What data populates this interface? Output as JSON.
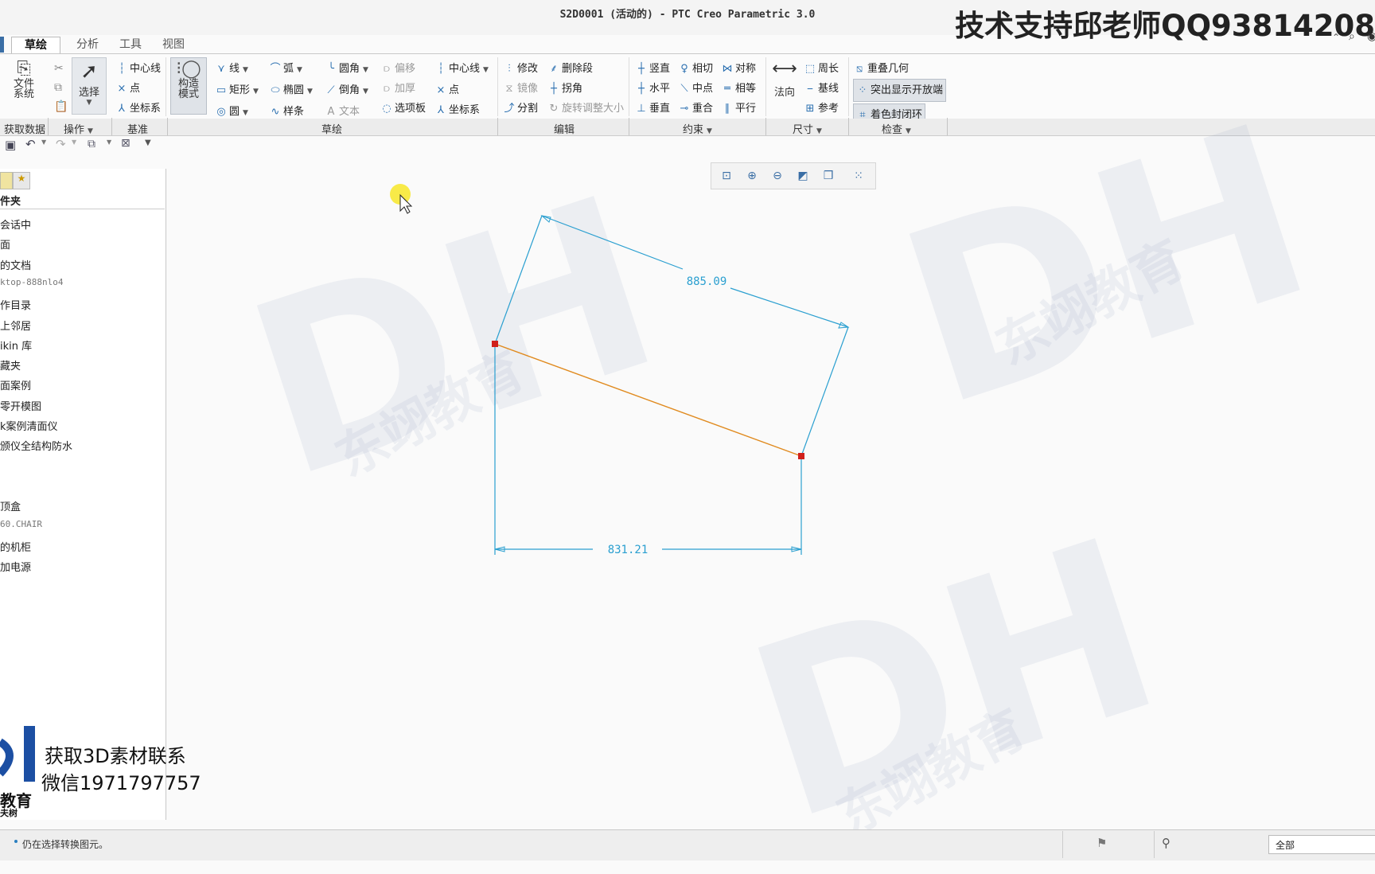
{
  "window": {
    "title": "S2D0001 (活动的) - PTC Creo Parametric 3.0",
    "overlay_contact": "技术支持邱老师QQ93814208"
  },
  "tabs": [
    {
      "label": "草绘",
      "active": true
    },
    {
      "label": "分析",
      "active": false
    },
    {
      "label": "工具",
      "active": false
    },
    {
      "label": "视图",
      "active": false
    }
  ],
  "ribbon": {
    "file_system": "文件\n系统",
    "select": "选择",
    "construct_mode": "构造\n模式",
    "datum": {
      "centerline": "中心线",
      "point": "点",
      "coord": "坐标系"
    },
    "sketch": {
      "line": "线",
      "arc": "弧",
      "fillet": "圆角",
      "offset": "偏移",
      "rect": "矩形",
      "ellipse": "椭圆",
      "chamfer": "倒角",
      "thicken": "加厚",
      "circle": "圆",
      "spline": "样条",
      "text": "文本",
      "palette": "选项板",
      "centerline": "中心线",
      "point": "点",
      "coord": "坐标系"
    },
    "edit": {
      "modify": "修改",
      "delete_seg": "删除段",
      "mirror": "镜像",
      "corner": "拐角",
      "divide": "分割",
      "rotate_resize": "旋转调整大小"
    },
    "constrain": {
      "vertical": "竖直",
      "tangent": "相切",
      "symmetric": "对称",
      "horizontal": "水平",
      "midpoint": "中点",
      "equal": "相等",
      "perpendicular": "垂直",
      "coincident": "重合",
      "parallel": "平行"
    },
    "dimension": {
      "normal": "法向",
      "perimeter": "周长",
      "baseline": "基线",
      "reference": "参考"
    },
    "inspect": {
      "overlap": "重叠几何",
      "highlight_open": "突出显示开放端",
      "shade_closed": "着色封闭环"
    }
  },
  "groups": [
    "获取数据",
    "操作",
    "基准",
    "草绘",
    "编辑",
    "约束",
    "尺寸",
    "检查"
  ],
  "folder_panel": {
    "header": "件夹",
    "items": [
      "会话中",
      "面",
      "的文档",
      "ktop-888nlo4",
      "作目录",
      "上邻居",
      "ikin 库",
      "藏夹",
      "面案例",
      "零开模图",
      "k案例清面仪",
      "颁仪全结构防水",
      "",
      "",
      "顶盒",
      "60.CHAIR",
      "的机柜",
      "加电源"
    ]
  },
  "sketch": {
    "dim_top": "885.09",
    "dim_bottom": "831.21",
    "line_color": "#2a9fd0",
    "selected_line_color": "#e08a1e",
    "vertex_color": "#d0201b"
  },
  "status": {
    "message": "仍在选择转换图元。",
    "filter": "全部"
  },
  "watermarks": {
    "bottom_left_line1": "获取3D素材联系",
    "bottom_left_line2": "微信1971797757",
    "bottom_left_brand": "教育",
    "bottom_left_small": "夫树",
    "bg_brand": "东翊教育"
  }
}
